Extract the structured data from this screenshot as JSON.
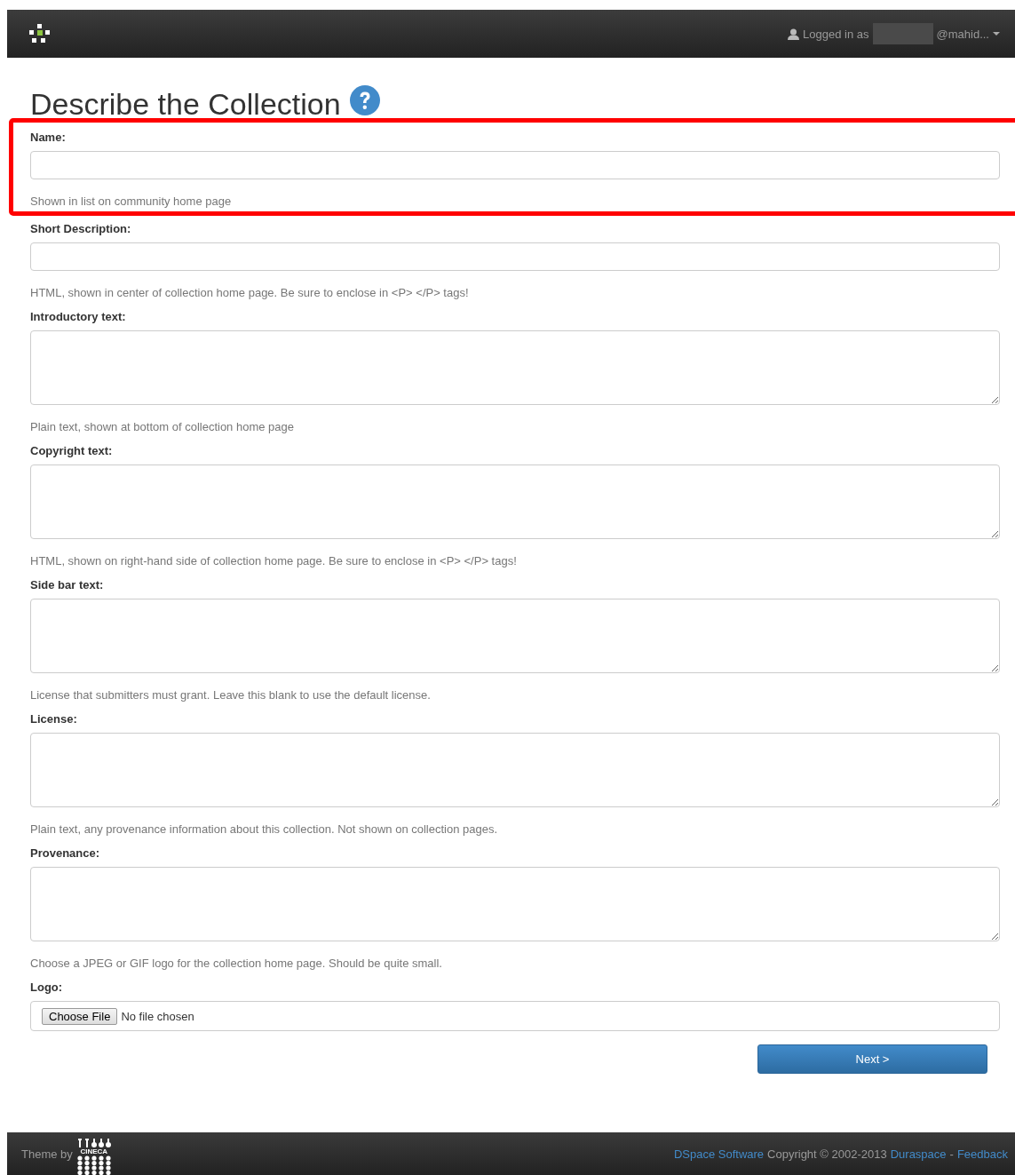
{
  "navbar": {
    "logged_in_label": "Logged in as",
    "user_suffix": "@mahid..."
  },
  "heading": "Describe the Collection",
  "fields": [
    {
      "label": "Name:",
      "kind": "input",
      "help": "Shown in list on community home page"
    },
    {
      "label": "Short Description:",
      "kind": "input",
      "help": "HTML, shown in center of collection home page. Be sure to enclose in <P> </P> tags!"
    },
    {
      "label": "Introductory text:",
      "kind": "textarea",
      "help": "Plain text, shown at bottom of collection home page"
    },
    {
      "label": "Copyright text:",
      "kind": "textarea",
      "help": "HTML, shown on right-hand side of collection home page. Be sure to enclose in <P> </P> tags!"
    },
    {
      "label": "Side bar text:",
      "kind": "textarea",
      "help": "License that submitters must grant. Leave this blank to use the default license."
    },
    {
      "label": "License:",
      "kind": "textarea",
      "help": "Plain text, any provenance information about this collection. Not shown on collection pages."
    },
    {
      "label": "Provenance:",
      "kind": "textarea",
      "help": "Choose a JPEG or GIF logo for the collection home page. Should be quite small."
    },
    {
      "label": "Logo:",
      "kind": "file",
      "button": "Choose File",
      "status": "No file chosen"
    }
  ],
  "next_button": "Next >",
  "footer": {
    "theme_label": "Theme by",
    "theme_logo_text": "CINECA",
    "links": [
      {
        "kind": "link",
        "text": "DSpace Software"
      },
      {
        "kind": "text",
        "text": "Copyright © 2002-2013"
      },
      {
        "kind": "link",
        "text": "Duraspace"
      },
      {
        "kind": "text",
        "text": "-"
      },
      {
        "kind": "link",
        "text": "Feedback"
      }
    ]
  }
}
